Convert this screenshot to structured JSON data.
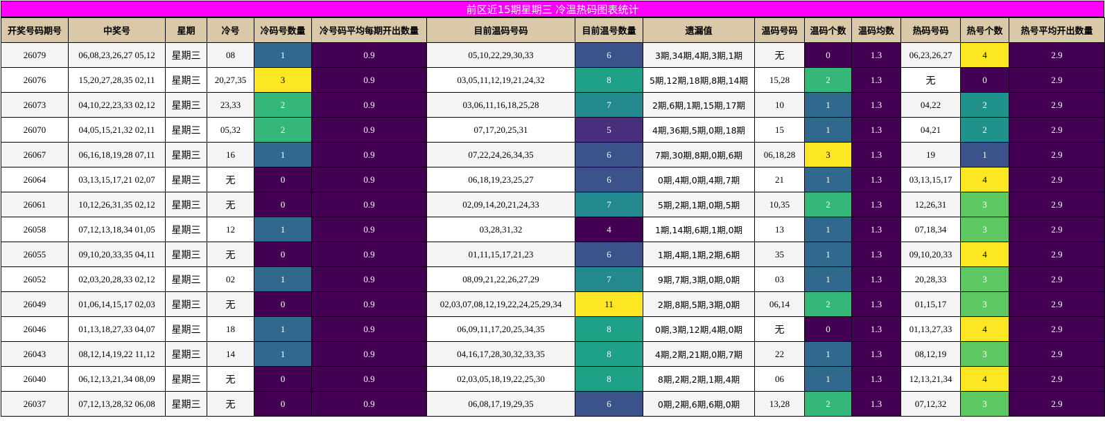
{
  "title": "前区近15期星期三 冷温热码图表统计",
  "headers": [
    "开奖号码期号",
    "中奖号",
    "星期",
    "冷号",
    "冷码号数量",
    "冷号码平均每期开出数量",
    "目前温码号码",
    "目前温号数量",
    "遗漏值",
    "温码号码",
    "温码个数",
    "温码均数",
    "热码号码",
    "热号个数",
    "热号平均开出数量"
  ],
  "colors": {
    "header_bg": "#d9c9a8",
    "title_bg": "#ff00ff",
    "avg_bg": "#440154",
    "scale": {
      "0": "#440154",
      "1": "#31688e",
      "2": "#35b779",
      "3": "#fde725",
      "4": "#fde725",
      "5": "#472f7d",
      "6": "#3b528b",
      "7": "#23898e",
      "8": "#1fa187",
      "11": "#fde725"
    },
    "warm_count": {
      "4": "#440154",
      "5": "#472f7d",
      "6": "#3b528b",
      "7": "#23898e",
      "8": "#1fa187",
      "11": "#fde725"
    },
    "cold_count": {
      "0": "#440154",
      "1": "#31688e",
      "2": "#35b779",
      "3": "#fde725"
    },
    "mid_count": {
      "0": "#440154",
      "1": "#31688e",
      "2": "#35b779",
      "3": "#fde725"
    },
    "hot_count": {
      "0": "#440154",
      "1": "#3b528b",
      "2": "#21918c",
      "3": "#5ec962",
      "4": "#fde725"
    }
  },
  "rows": [
    {
      "issue": "26079",
      "winning": "06,08,23,26,27 05,12",
      "weekday": "星期三",
      "cold": "08",
      "cold_count": "1",
      "cold_avg": "0.9",
      "warm_nums": "05,10,22,29,30,33",
      "warm_count": "6",
      "missing": "3期,34期,4期,3期,1期",
      "mid_nums": "无",
      "mid_count": "0",
      "mid_avg": "1.3",
      "hot_nums": "06,23,26,27",
      "hot_count": "4",
      "hot_avg": "2.9"
    },
    {
      "issue": "26076",
      "winning": "15,20,27,28,35 02,11",
      "weekday": "星期三",
      "cold": "20,27,35",
      "cold_count": "3",
      "cold_avg": "0.9",
      "warm_nums": "03,05,11,12,19,21,24,32",
      "warm_count": "8",
      "missing": "5期,12期,18期,8期,14期",
      "mid_nums": "15,28",
      "mid_count": "2",
      "mid_avg": "1.3",
      "hot_nums": "无",
      "hot_count": "0",
      "hot_avg": "2.9"
    },
    {
      "issue": "26073",
      "winning": "04,10,22,23,33 02,12",
      "weekday": "星期三",
      "cold": "23,33",
      "cold_count": "2",
      "cold_avg": "0.9",
      "warm_nums": "03,06,11,16,18,25,28",
      "warm_count": "7",
      "missing": "2期,6期,1期,15期,17期",
      "mid_nums": "10",
      "mid_count": "1",
      "mid_avg": "1.3",
      "hot_nums": "04,22",
      "hot_count": "2",
      "hot_avg": "2.9"
    },
    {
      "issue": "26070",
      "winning": "04,05,15,21,32 02,11",
      "weekday": "星期三",
      "cold": "05,32",
      "cold_count": "2",
      "cold_avg": "0.9",
      "warm_nums": "07,17,20,25,31",
      "warm_count": "5",
      "missing": "4期,36期,5期,0期,18期",
      "mid_nums": "15",
      "mid_count": "1",
      "mid_avg": "1.3",
      "hot_nums": "04,21",
      "hot_count": "2",
      "hot_avg": "2.9"
    },
    {
      "issue": "26067",
      "winning": "06,16,18,19,28 07,11",
      "weekday": "星期三",
      "cold": "16",
      "cold_count": "1",
      "cold_avg": "0.9",
      "warm_nums": "07,22,24,26,34,35",
      "warm_count": "6",
      "missing": "7期,30期,8期,0期,6期",
      "mid_nums": "06,18,28",
      "mid_count": "3",
      "mid_avg": "1.3",
      "hot_nums": "19",
      "hot_count": "1",
      "hot_avg": "2.9"
    },
    {
      "issue": "26064",
      "winning": "03,13,15,17,21 02,07",
      "weekday": "星期三",
      "cold": "无",
      "cold_count": "0",
      "cold_avg": "0.9",
      "warm_nums": "06,18,19,23,25,27",
      "warm_count": "6",
      "missing": "0期,4期,0期,4期,7期",
      "mid_nums": "21",
      "mid_count": "1",
      "mid_avg": "1.3",
      "hot_nums": "03,13,15,17",
      "hot_count": "4",
      "hot_avg": "2.9"
    },
    {
      "issue": "26061",
      "winning": "10,12,26,31,35 02,12",
      "weekday": "星期三",
      "cold": "无",
      "cold_count": "0",
      "cold_avg": "0.9",
      "warm_nums": "02,09,14,20,21,24,33",
      "warm_count": "7",
      "missing": "5期,2期,1期,0期,5期",
      "mid_nums": "10,35",
      "mid_count": "2",
      "mid_avg": "1.3",
      "hot_nums": "12,26,31",
      "hot_count": "3",
      "hot_avg": "2.9"
    },
    {
      "issue": "26058",
      "winning": "07,12,13,18,34 01,05",
      "weekday": "星期三",
      "cold": "12",
      "cold_count": "1",
      "cold_avg": "0.9",
      "warm_nums": "03,28,31,32",
      "warm_count": "4",
      "missing": "1期,14期,6期,1期,0期",
      "mid_nums": "13",
      "mid_count": "1",
      "mid_avg": "1.3",
      "hot_nums": "07,18,34",
      "hot_count": "3",
      "hot_avg": "2.9"
    },
    {
      "issue": "26055",
      "winning": "09,10,20,33,35 04,11",
      "weekday": "星期三",
      "cold": "无",
      "cold_count": "0",
      "cold_avg": "0.9",
      "warm_nums": "01,11,15,17,21,23",
      "warm_count": "6",
      "missing": "1期,4期,1期,2期,6期",
      "mid_nums": "35",
      "mid_count": "1",
      "mid_avg": "1.3",
      "hot_nums": "09,10,20,33",
      "hot_count": "4",
      "hot_avg": "2.9"
    },
    {
      "issue": "26052",
      "winning": "02,03,20,28,33 02,12",
      "weekday": "星期三",
      "cold": "02",
      "cold_count": "1",
      "cold_avg": "0.9",
      "warm_nums": "08,09,21,22,26,27,29",
      "warm_count": "7",
      "missing": "9期,7期,3期,0期,0期",
      "mid_nums": "03",
      "mid_count": "1",
      "mid_avg": "1.3",
      "hot_nums": "20,28,33",
      "hot_count": "3",
      "hot_avg": "2.9"
    },
    {
      "issue": "26049",
      "winning": "01,06,14,15,17 02,03",
      "weekday": "星期三",
      "cold": "无",
      "cold_count": "0",
      "cold_avg": "0.9",
      "warm_nums": "02,03,07,08,12,19,22,24,25,29,34",
      "warm_count": "11",
      "missing": "2期,8期,5期,3期,0期",
      "mid_nums": "06,14",
      "mid_count": "2",
      "mid_avg": "1.3",
      "hot_nums": "01,15,17",
      "hot_count": "3",
      "hot_avg": "2.9"
    },
    {
      "issue": "26046",
      "winning": "01,13,18,27,33 04,07",
      "weekday": "星期三",
      "cold": "18",
      "cold_count": "1",
      "cold_avg": "0.9",
      "warm_nums": "06,09,11,17,20,25,34,35",
      "warm_count": "8",
      "missing": "0期,3期,12期,4期,0期",
      "mid_nums": "无",
      "mid_count": "0",
      "mid_avg": "1.3",
      "hot_nums": "01,13,27,33",
      "hot_count": "4",
      "hot_avg": "2.9"
    },
    {
      "issue": "26043",
      "winning": "08,12,14,19,22 11,12",
      "weekday": "星期三",
      "cold": "14",
      "cold_count": "1",
      "cold_avg": "0.9",
      "warm_nums": "04,16,17,28,30,32,33,35",
      "warm_count": "8",
      "missing": "4期,2期,21期,0期,7期",
      "mid_nums": "22",
      "mid_count": "1",
      "mid_avg": "1.3",
      "hot_nums": "08,12,19",
      "hot_count": "3",
      "hot_avg": "2.9"
    },
    {
      "issue": "26040",
      "winning": "06,12,13,21,34 08,09",
      "weekday": "星期三",
      "cold": "无",
      "cold_count": "0",
      "cold_avg": "0.9",
      "warm_nums": "02,03,05,18,19,22,25,30",
      "warm_count": "8",
      "missing": "8期,2期,2期,1期,4期",
      "mid_nums": "06",
      "mid_count": "1",
      "mid_avg": "1.3",
      "hot_nums": "12,13,21,34",
      "hot_count": "4",
      "hot_avg": "2.9"
    },
    {
      "issue": "26037",
      "winning": "07,12,13,28,32 06,08",
      "weekday": "星期三",
      "cold": "无",
      "cold_count": "0",
      "cold_avg": "0.9",
      "warm_nums": "06,08,17,19,29,35",
      "warm_count": "6",
      "missing": "0期,2期,6期,6期,0期",
      "mid_nums": "13,28",
      "mid_count": "2",
      "mid_avg": "1.3",
      "hot_nums": "07,12,32",
      "hot_count": "3",
      "hot_avg": "2.9"
    }
  ]
}
